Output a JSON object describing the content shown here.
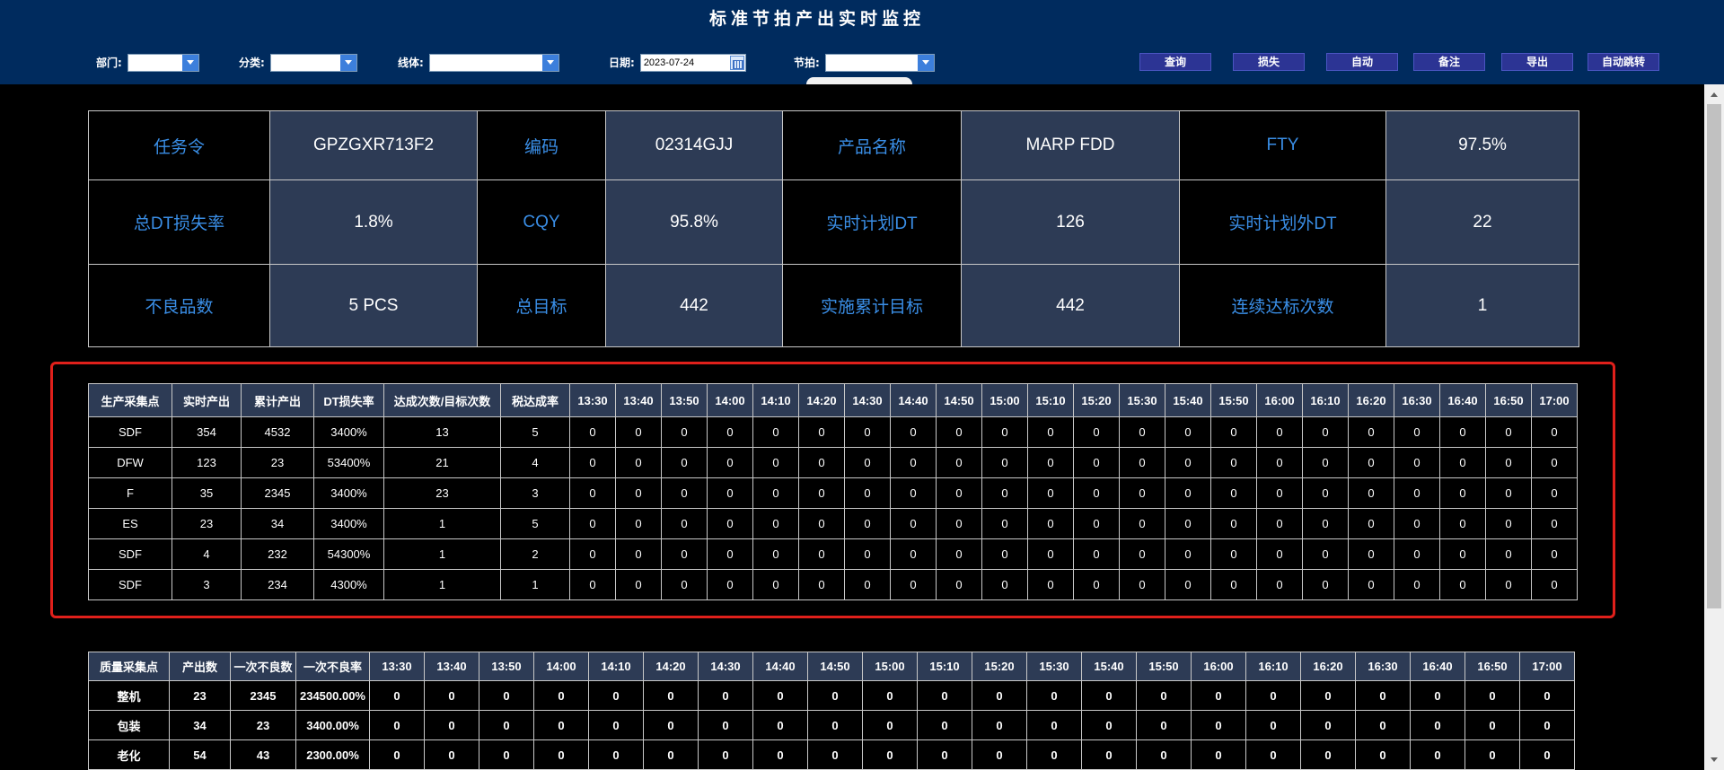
{
  "header": {
    "title": "标准节拍产出实时监控"
  },
  "filters": {
    "department_label": "部门:",
    "category_label": "分类:",
    "line_label": "线体:",
    "date_label": "日期:",
    "date_value": "2023-07-24",
    "takt_label": "节拍:"
  },
  "buttons": {
    "query": "查询",
    "loss": "损失",
    "auto": "自动",
    "remark": "备注",
    "export": "导出",
    "auto_jump": "自动跳转"
  },
  "info": {
    "task_order_label": "任务令",
    "task_order_value": "GPZGXR713F2",
    "code_label": "编码",
    "code_value": "02314GJJ",
    "product_name_label": "产品名称",
    "product_name_value": "MARP FDD",
    "fty_label": "FTY",
    "fty_value": "97.5%",
    "total_dt_loss_label": "总DT损失率",
    "total_dt_loss_value": "1.8%",
    "cqy_label": "CQY",
    "cqy_value": "95.8%",
    "plan_dt_label": "实时计划DT",
    "plan_dt_value": "126",
    "unplan_dt_label": "实时计划外DT",
    "unplan_dt_value": "22",
    "defect_label": "不良品数",
    "defect_value": "5 PCS",
    "total_target_label": "总目标",
    "total_target_value": "442",
    "cum_target_label": "实施累计目标",
    "cum_target_value": "442",
    "consecutive_label": "连续达标次数",
    "consecutive_value": "1"
  },
  "production": {
    "headers": [
      "生产采集点",
      "实时产出",
      "累计产出",
      "DT损失率",
      "达成次数/目标次数",
      "税达成率",
      "13:30",
      "13:40",
      "13:50",
      "14:00",
      "14:10",
      "14:20",
      "14:30",
      "14:40",
      "14:50",
      "15:00",
      "15:10",
      "15:20",
      "15:30",
      "15:40",
      "15:50",
      "16:00",
      "16:10",
      "16:20",
      "16:30",
      "16:40",
      "16:50",
      "17:00"
    ],
    "rows": [
      [
        "SDF",
        "354",
        "4532",
        "3400%",
        "13",
        "5",
        "0",
        "0",
        "0",
        "0",
        "0",
        "0",
        "0",
        "0",
        "0",
        "0",
        "0",
        "0",
        "0",
        "0",
        "0",
        "0",
        "0",
        "0",
        "0",
        "0",
        "0",
        "0"
      ],
      [
        "DFW",
        "123",
        "23",
        "53400%",
        "21",
        "4",
        "0",
        "0",
        "0",
        "0",
        "0",
        "0",
        "0",
        "0",
        "0",
        "0",
        "0",
        "0",
        "0",
        "0",
        "0",
        "0",
        "0",
        "0",
        "0",
        "0",
        "0",
        "0"
      ],
      [
        "F",
        "35",
        "2345",
        "3400%",
        "23",
        "3",
        "0",
        "0",
        "0",
        "0",
        "0",
        "0",
        "0",
        "0",
        "0",
        "0",
        "0",
        "0",
        "0",
        "0",
        "0",
        "0",
        "0",
        "0",
        "0",
        "0",
        "0",
        "0"
      ],
      [
        "ES",
        "23",
        "34",
        "3400%",
        "1",
        "5",
        "0",
        "0",
        "0",
        "0",
        "0",
        "0",
        "0",
        "0",
        "0",
        "0",
        "0",
        "0",
        "0",
        "0",
        "0",
        "0",
        "0",
        "0",
        "0",
        "0",
        "0",
        "0"
      ],
      [
        "SDF",
        "4",
        "232",
        "54300%",
        "1",
        "2",
        "0",
        "0",
        "0",
        "0",
        "0",
        "0",
        "0",
        "0",
        "0",
        "0",
        "0",
        "0",
        "0",
        "0",
        "0",
        "0",
        "0",
        "0",
        "0",
        "0",
        "0",
        "0"
      ],
      [
        "SDF",
        "3",
        "234",
        "4300%",
        "1",
        "1",
        "0",
        "0",
        "0",
        "0",
        "0",
        "0",
        "0",
        "0",
        "0",
        "0",
        "0",
        "0",
        "0",
        "0",
        "0",
        "0",
        "0",
        "0",
        "0",
        "0",
        "0",
        "0"
      ]
    ]
  },
  "quality": {
    "headers": [
      "质量采集点",
      "产出数",
      "一次不良数",
      "一次不良率",
      "13:30",
      "13:40",
      "13:50",
      "14:00",
      "14:10",
      "14:20",
      "14:30",
      "14:40",
      "14:50",
      "15:00",
      "15:10",
      "15:20",
      "15:30",
      "15:40",
      "15:50",
      "16:00",
      "16:10",
      "16:20",
      "16:30",
      "16:40",
      "16:50",
      "17:00"
    ],
    "rows": [
      [
        "整机",
        "23",
        "2345",
        "234500.00%",
        "0",
        "0",
        "0",
        "0",
        "0",
        "0",
        "0",
        "0",
        "0",
        "0",
        "0",
        "0",
        "0",
        "0",
        "0",
        "0",
        "0",
        "0",
        "0",
        "0",
        "0",
        "0"
      ],
      [
        "包装",
        "34",
        "23",
        "3400.00%",
        "0",
        "0",
        "0",
        "0",
        "0",
        "0",
        "0",
        "0",
        "0",
        "0",
        "0",
        "0",
        "0",
        "0",
        "0",
        "0",
        "0",
        "0",
        "0",
        "0",
        "0",
        "0"
      ],
      [
        "老化",
        "54",
        "43",
        "2300.00%",
        "0",
        "0",
        "0",
        "0",
        "0",
        "0",
        "0",
        "0",
        "0",
        "0",
        "0",
        "0",
        "0",
        "0",
        "0",
        "0",
        "0",
        "0",
        "0",
        "0",
        "0",
        "0"
      ]
    ]
  }
}
